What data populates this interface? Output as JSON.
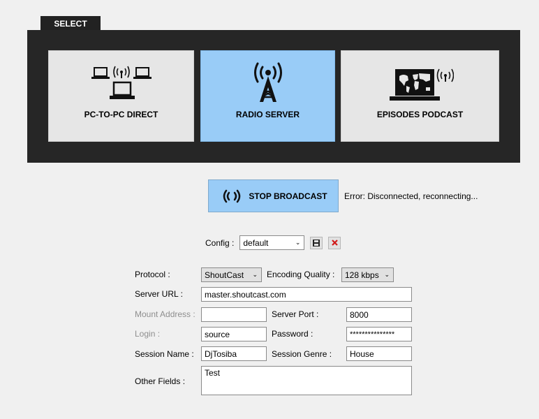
{
  "select_tab": {
    "label": "SELECT"
  },
  "modes": [
    {
      "label": "PC-TO-PC DIRECT",
      "icon": "laptops-network-icon",
      "active": false
    },
    {
      "label": "RADIO SERVER",
      "icon": "radio-tower-icon",
      "active": true
    },
    {
      "label": "EPISODES PODCAST",
      "icon": "world-map-laptop-icon",
      "active": false
    }
  ],
  "broadcast": {
    "button_label": "STOP BROADCAST",
    "status": "Error: Disconnected, reconnecting..."
  },
  "config": {
    "label": "Config :",
    "selected": "default"
  },
  "form": {
    "protocol_label": "Protocol :",
    "protocol_value": "ShoutCast",
    "quality_label": "Encoding Quality :",
    "quality_value": "128 kbps",
    "server_url_label": "Server URL :",
    "server_url_value": "master.shoutcast.com",
    "mount_label": "Mount Address :",
    "mount_value": "",
    "port_label": "Server Port :",
    "port_value": "8000",
    "login_label": "Login :",
    "login_value": "source",
    "password_label": "Password :",
    "password_value": "***************",
    "session_name_label": "Session Name :",
    "session_name_value": "DjTosiba",
    "session_genre_label": "Session Genre :",
    "session_genre_value": "House",
    "other_label": "Other Fields :",
    "other_value": "Test"
  },
  "colors": {
    "active": "#99ccf7",
    "panel": "#262626",
    "delete_red": "#d11a1a"
  }
}
